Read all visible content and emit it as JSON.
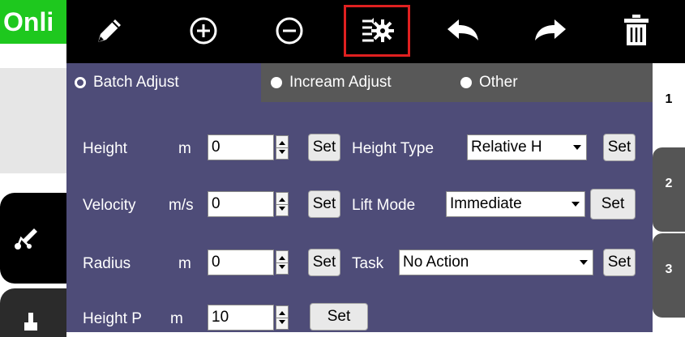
{
  "status": {
    "online_label": "Onli"
  },
  "toolbar": {
    "tools": [
      {
        "name": "edit",
        "icon": "pencil-icon"
      },
      {
        "name": "add",
        "icon": "plus-circle-icon"
      },
      {
        "name": "remove",
        "icon": "minus-circle-icon"
      },
      {
        "name": "batch-settings",
        "icon": "gear-adjust-icon",
        "selected": true
      },
      {
        "name": "undo",
        "icon": "undo-arrow-icon"
      },
      {
        "name": "redo",
        "icon": "redo-arrow-icon"
      },
      {
        "name": "delete",
        "icon": "trash-icon"
      }
    ]
  },
  "adjust_mode": {
    "options": [
      {
        "label": "Batch Adjust",
        "selected": true
      },
      {
        "label": "Incream Adjust",
        "selected": false
      },
      {
        "label": "Other",
        "selected": false
      }
    ]
  },
  "fields": {
    "height": {
      "label": "Height",
      "unit": "m",
      "value": "0",
      "set": "Set"
    },
    "velocity": {
      "label": "Velocity",
      "unit": "m/s",
      "value": "0",
      "set": "Set"
    },
    "radius": {
      "label": "Radius",
      "unit": "m",
      "value": "0",
      "set": "Set"
    },
    "height_p": {
      "label": "Height P",
      "unit": "m",
      "value": "10",
      "set": "Set"
    }
  },
  "selects": {
    "height_type": {
      "label": "Height Type",
      "value": "Relative H",
      "set": "Set"
    },
    "lift_mode": {
      "label": "Lift Mode",
      "value": "Immediate",
      "set": "Set"
    },
    "task": {
      "label": "Task",
      "value": "No Action",
      "set": "Set"
    }
  },
  "tabs": [
    {
      "label": "1",
      "active": true
    },
    {
      "label": "2",
      "active": false
    },
    {
      "label": "3",
      "active": false
    }
  ],
  "colors": {
    "online_green": "#1ec81e",
    "panel": "#4e4c78",
    "toolbar": "#000000",
    "selected_outline": "#e02020"
  }
}
